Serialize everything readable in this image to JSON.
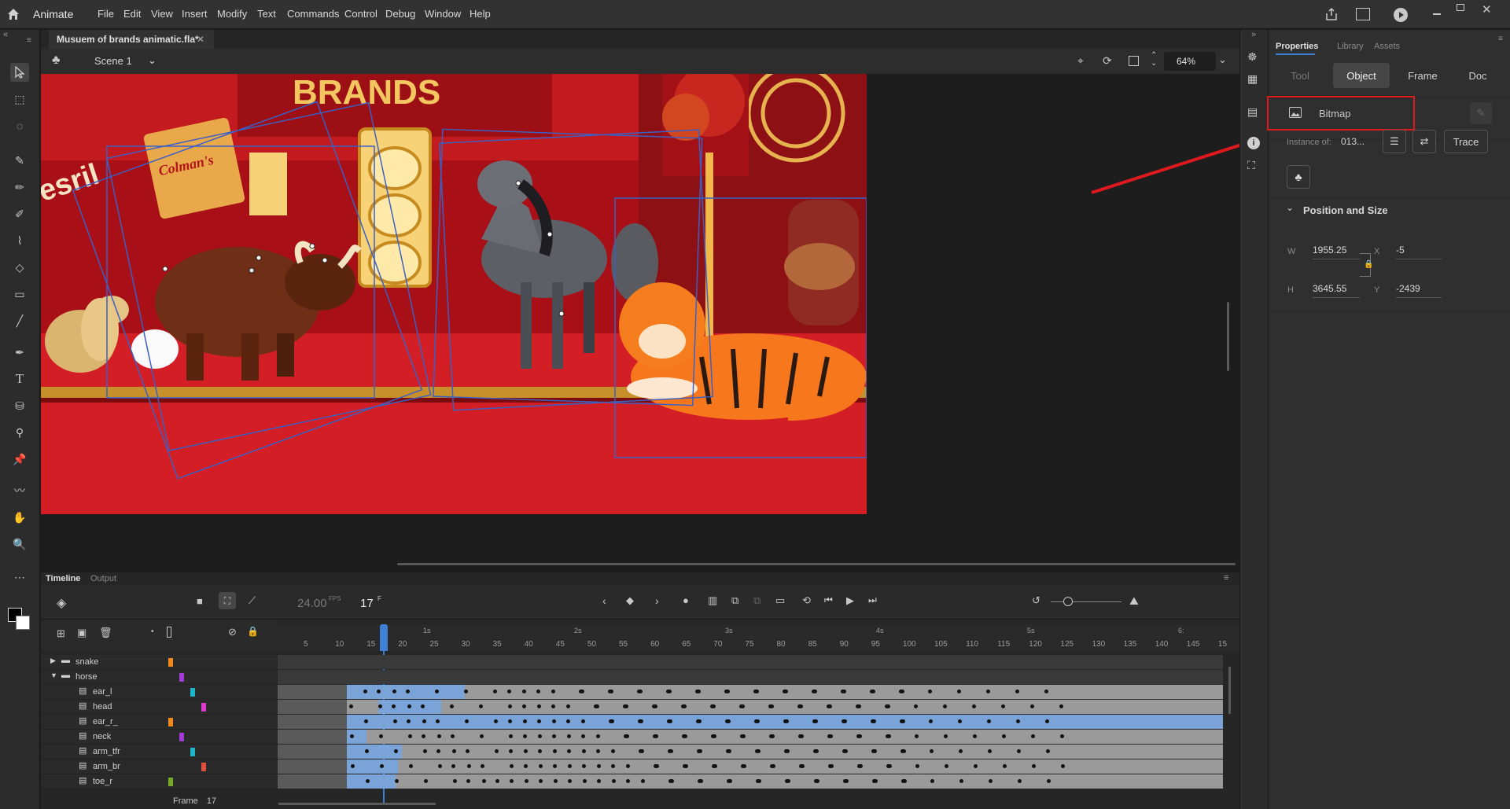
{
  "app": {
    "name": "Animate"
  },
  "menu": [
    "File",
    "Edit",
    "View",
    "Insert",
    "Modify",
    "Text",
    "Commands",
    "Control",
    "Debug",
    "Window",
    "Help"
  ],
  "document": {
    "tab_title": "Musuem of brands animatic.fla*",
    "scene": "Scene 1",
    "zoom": "64%"
  },
  "stage": {
    "sign_text": "BRANDS",
    "box_text": "Colman's",
    "left_text": "esril"
  },
  "properties": {
    "tabs": [
      "Properties",
      "Library",
      "Assets"
    ],
    "segments": [
      "Tool",
      "Object",
      "Frame",
      "Doc"
    ],
    "selected_segment": "Object",
    "object_type": "Bitmap",
    "instance_label": "Instance of:",
    "instance_value": "013...",
    "trace_label": "Trace",
    "section_title": "Position and Size",
    "w_label": "W",
    "w_value": "1955.25",
    "h_label": "H",
    "h_value": "3645.55",
    "x_label": "X",
    "x_value": "-5",
    "y_label": "Y",
    "y_value": "-2439"
  },
  "timeline": {
    "tabs": [
      "Timeline",
      "Output"
    ],
    "fps": "24.00",
    "fps_unit": "FPS",
    "frame": "17",
    "frame_unit": "F",
    "frame_label": "Frame",
    "frame_number": "17",
    "ruler_ticks": [
      "5",
      "10",
      "15",
      "20",
      "25",
      "30",
      "35",
      "40",
      "45",
      "50",
      "55",
      "60",
      "65",
      "70",
      "75",
      "80",
      "85",
      "90",
      "95",
      "100",
      "105",
      "110",
      "115",
      "120",
      "125",
      "130",
      "135",
      "140",
      "145",
      "15"
    ],
    "second_marks": [
      "1s",
      "2s",
      "3s",
      "4s",
      "5s",
      "6:"
    ],
    "layers": [
      "snake",
      "horse",
      "ear_l",
      "head",
      "ear_r_",
      "neck",
      "arm_tfr",
      "arm_br",
      "toe_r"
    ]
  },
  "colors": {
    "accent": "#3b7fd0",
    "stage_red": "#b7141b",
    "selection_red": "#e0191f",
    "playhead": "#3f7fd6"
  }
}
